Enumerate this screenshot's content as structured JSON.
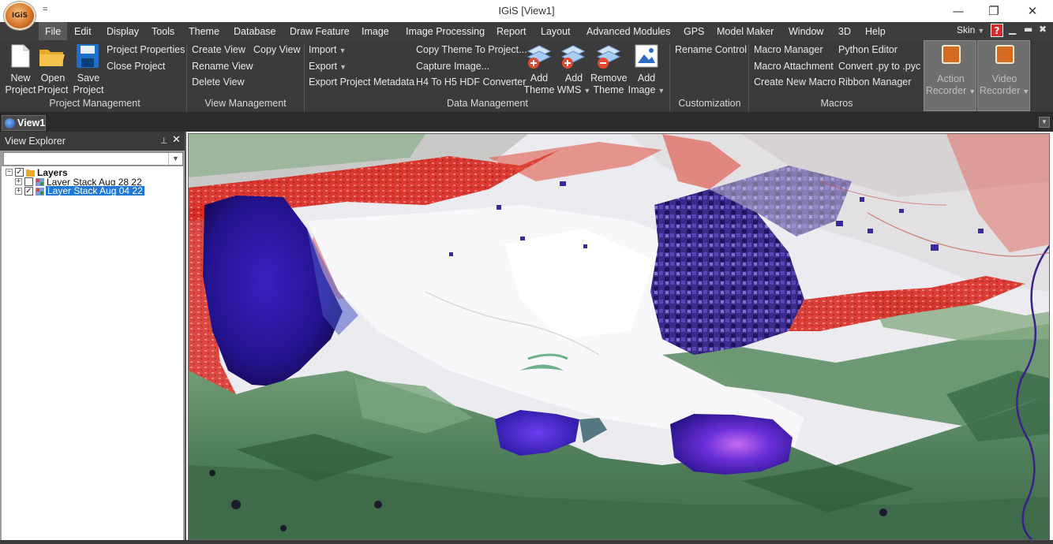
{
  "window": {
    "title": "IGiS  [View1]",
    "logo_text": "IGiS",
    "qat_symbol": "=",
    "minimize": "—",
    "restore": "❐",
    "close": "✕"
  },
  "menubar": {
    "items": [
      "File",
      "Edit",
      "Display",
      "Tools",
      "Theme",
      "Database",
      "Draw Feature",
      "Image",
      "Image Processing",
      "Report",
      "Layout",
      "Advanced Modules",
      "GPS",
      "Model Maker",
      "Window",
      "3D",
      "Help"
    ],
    "skin_label": "Skin",
    "help_symbol": "?",
    "mdi_minimize": "▁",
    "mdi_restore": "▬",
    "mdi_close": "✖"
  },
  "ribbon": {
    "project_management": {
      "new_line1": "New",
      "new_line2": "Project",
      "open_line1": "Open",
      "open_line2": "Project",
      "save_line1": "Save",
      "save_line2": "Project",
      "project_properties": "Project Properties",
      "close_project": "Close Project",
      "caption": "Project Management"
    },
    "view_management": {
      "create_view": "Create View",
      "copy_view": "Copy View",
      "rename_view": "Rename View",
      "delete_view": "Delete View",
      "caption": "View Management"
    },
    "data_management": {
      "import": "Import",
      "export": "Export",
      "export_project_metadata": "Export Project Metadata",
      "copy_theme_to_project": "Copy Theme To Project...",
      "capture_image": "Capture Image...",
      "h4_to_h5": "H4 To H5 HDF Converter",
      "add_theme_line1": "Add",
      "add_theme_line2": "Theme",
      "add_wms_line1": "Add",
      "add_wms_line2": "WMS",
      "remove_theme_line1": "Remove",
      "remove_theme_line2": "Theme",
      "add_image_line1": "Add",
      "add_image_line2": "Image",
      "caption": "Data Management"
    },
    "customization": {
      "rename_control": "Rename Control",
      "caption": "Customization"
    },
    "macros": {
      "macro_manager": "Macro Manager",
      "python_editor": "Python Editor",
      "macro_attachment": "Macro Attachment",
      "convert_py": "Convert .py to .pyc",
      "create_new_macro": "Create New Macro",
      "ribbon_manager": "Ribbon Manager",
      "caption": "Macros"
    },
    "recorders": {
      "action_line1": "Action",
      "action_line2": "Recorder",
      "video_line1": "Video",
      "video_line2": "Recorder"
    }
  },
  "tabs": {
    "view1": "View1",
    "strip_menu": "▼"
  },
  "explorer": {
    "title": "View Explorer",
    "pin": "📌",
    "close": "✕",
    "combo_value": "",
    "combo_arrow": "▼",
    "tree": {
      "root_label": "Layers",
      "root_checked": true,
      "layers": [
        {
          "label": "Layer Stack Aug 28 22",
          "checked": false,
          "selected": false
        },
        {
          "label": "Layer Stack Aug 04 22",
          "checked": true,
          "selected": true
        }
      ]
    }
  },
  "colors": {
    "dark_chrome": "#3b3b3b",
    "selection": "#1e78d7",
    "water_blue": "#2d1aa8",
    "vegetation_red": "#e0241c",
    "terrain_green": "#4f8a5c"
  }
}
